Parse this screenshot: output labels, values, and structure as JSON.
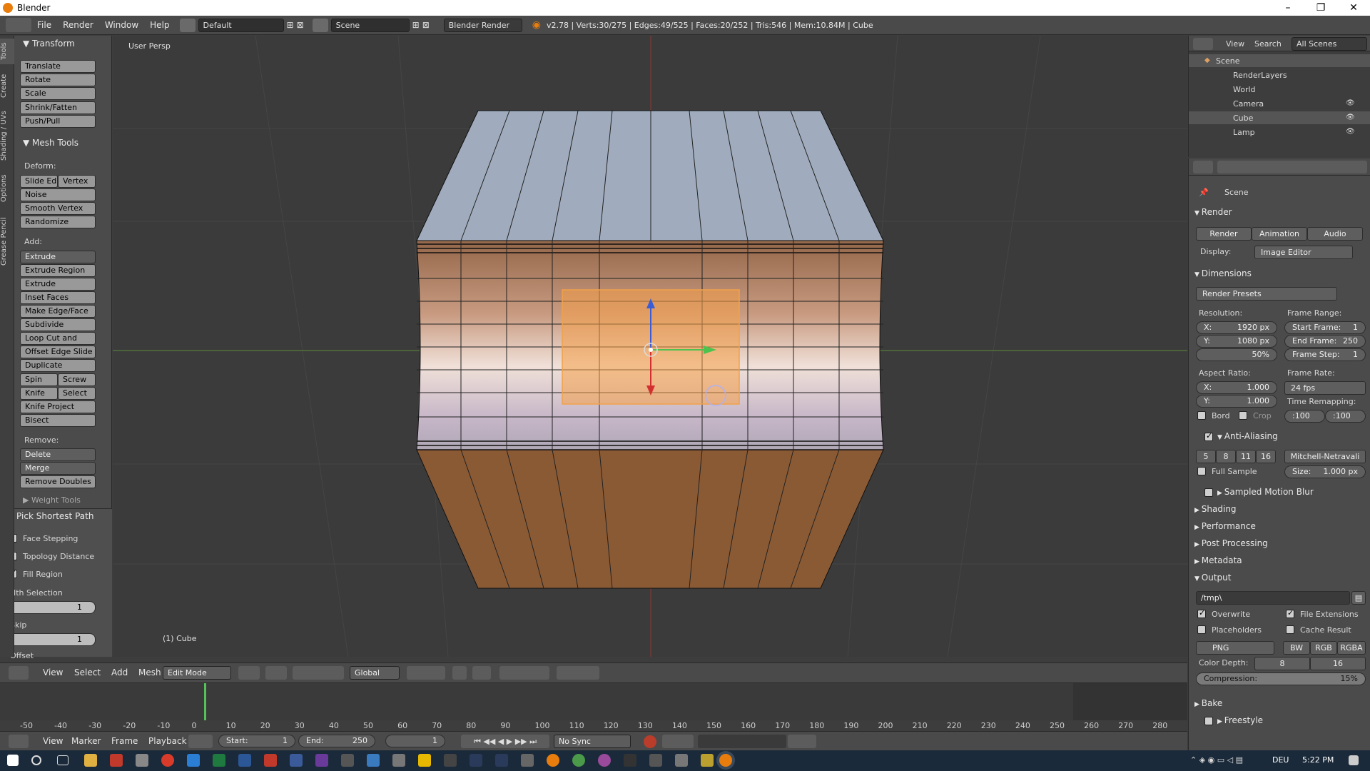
{
  "window": {
    "title": "Blender"
  },
  "info_header": {
    "menus": [
      "File",
      "Render",
      "Window",
      "Help"
    ],
    "layout": "Default",
    "scene": "Scene",
    "engine": "Blender Render",
    "stats": "v2.78 | Verts:30/275 | Edges:49/525 | Faces:20/252 | Tris:546 | Mem:10.84M | Cube"
  },
  "tool_shelf": {
    "tabs": [
      "Tools",
      "Create",
      "Shading / UVs",
      "Options",
      "Grease Pencil"
    ],
    "transform": {
      "title": "Transform",
      "buttons": [
        "Translate",
        "Rotate",
        "Scale",
        "Shrink/Fatten",
        "Push/Pull"
      ]
    },
    "mesh_tools": {
      "title": "Mesh Tools",
      "deform_label": "Deform:",
      "slide_edge": "Slide Ed",
      "vertex": "Vertex",
      "deform_buttons": [
        "Noise",
        "Smooth Vertex",
        "Randomize"
      ],
      "add_label": "Add:",
      "extrude": "Extrude",
      "add_buttons": [
        "Extrude Region",
        "Extrude Individual",
        "Inset Faces",
        "Make Edge/Face",
        "Subdivide",
        "Loop Cut and Slide",
        "Offset Edge Slide",
        "Duplicate"
      ],
      "spin": "Spin",
      "screw": "Screw",
      "knife": "Knife",
      "select": "Select",
      "knife_project": "Knife Project",
      "bisect": "Bisect",
      "remove_label": "Remove:",
      "delete": "Delete",
      "merge": "Merge",
      "remove_doubles": "Remove Doubles",
      "weight_tools": "Weight Tools"
    },
    "operator": {
      "title": "Pick Shortest Path",
      "face_stepping": "Face Stepping",
      "topology_distance": "Topology Distance",
      "fill_region": "Fill Region",
      "nth_selection_label": "Nth Selection",
      "nth_selection_value": "1",
      "skip_label": "Skip",
      "skip_value": "1",
      "offset_label": "Offset"
    }
  },
  "viewport": {
    "view_name": "User Persp",
    "object_label": "(1) Cube"
  },
  "view3d_header": {
    "menus": [
      "View",
      "Select",
      "Add",
      "Mesh"
    ],
    "mode": "Edit Mode",
    "orientation": "Global"
  },
  "timeline": {
    "ticks": [
      "-50",
      "-40",
      "-30",
      "-20",
      "-10",
      "0",
      "10",
      "20",
      "30",
      "40",
      "50",
      "60",
      "70",
      "80",
      "90",
      "100",
      "110",
      "120",
      "130",
      "140",
      "150",
      "160",
      "170",
      "180",
      "190",
      "200",
      "210",
      "220",
      "230",
      "240",
      "250",
      "260",
      "270",
      "280"
    ],
    "menus": [
      "View",
      "Marker",
      "Frame",
      "Playback"
    ],
    "start": "Start:",
    "start_value": "1",
    "end": "End:",
    "end_value": "250",
    "current": "1",
    "sync": "No Sync"
  },
  "outliner": {
    "menus": [
      "View",
      "Search"
    ],
    "filter": "All Scenes",
    "items": [
      "Scene",
      "RenderLayers",
      "World",
      "Camera",
      "Cube",
      "Lamp"
    ]
  },
  "properties": {
    "context": "Scene",
    "render": {
      "title": "Render",
      "render_btn": "Render",
      "animation_btn": "Animation",
      "audio_btn": "Audio",
      "display_label": "Display:",
      "display_value": "Image Editor"
    },
    "dimensions": {
      "title": "Dimensions",
      "presets": "Render Presets",
      "resolution_label": "Resolution:",
      "res_x": "X:",
      "res_x_value": "1920 px",
      "res_y": "Y:",
      "res_y_value": "1080 px",
      "res_pct": "50%",
      "frame_range_label": "Frame Range:",
      "start_frame": "Start Frame:",
      "start_frame_value": "1",
      "end_frame": "End Frame:",
      "end_frame_value": "250",
      "frame_step": "Frame Step:",
      "frame_step_value": "1",
      "aspect_label": "Aspect Ratio:",
      "asp_x": "X:",
      "asp_x_value": "1.000",
      "asp_y": "Y:",
      "asp_y_value": "1.000",
      "frame_rate_label": "Frame Rate:",
      "fps": "24 fps",
      "time_remap": "Time Remapping:",
      "remap_old": ":100",
      "remap_new": ":100",
      "bord": "Bord",
      "crop": "Crop"
    },
    "anti_aliasing": {
      "title": "Anti-Aliasing",
      "samples": [
        "5",
        "8",
        "11",
        "16"
      ],
      "filter": "Mitchell-Netravali",
      "full_sample": "Full Sample",
      "size": "Size:",
      "size_value": "1.000 px"
    },
    "collapsed": [
      "Sampled Motion Blur",
      "Shading",
      "Performance",
      "Post Processing",
      "Metadata"
    ],
    "output": {
      "title": "Output",
      "path": "/tmp\\",
      "overwrite": "Overwrite",
      "file_ext": "File Extensions",
      "placeholders": "Placeholders",
      "cache": "Cache Result",
      "format": "PNG",
      "bw": "BW",
      "rgb": "RGB",
      "rgba": "RGBA",
      "color_depth": "Color Depth:",
      "depth8": "8",
      "depth16": "16",
      "compression": "Compression:",
      "compression_value": "15%"
    },
    "bake": "Bake",
    "freestyle": "Freestyle"
  },
  "taskbar": {
    "lang": "DEU",
    "time": "5:22 PM"
  },
  "colors": {
    "accent": "#e87d0d",
    "selection": "#f0a14a",
    "blue_button": "#5680c2"
  }
}
